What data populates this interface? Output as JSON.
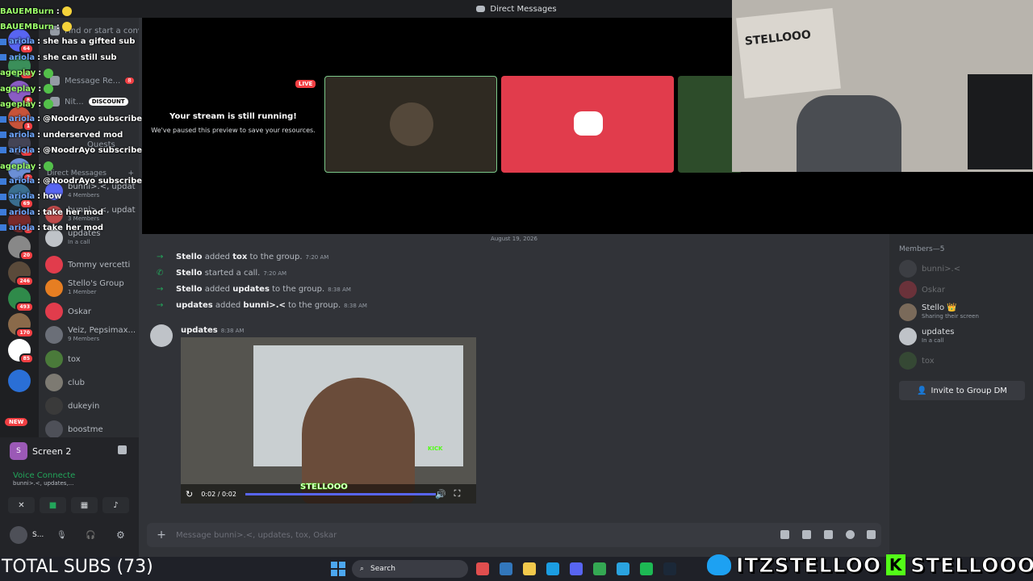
{
  "window": {
    "title": "Direct Messages"
  },
  "dm_sidebar": {
    "nav": [
      {
        "label": "Find or start a convers...",
        "icon": "search-icon"
      },
      {
        "label": "Message Re...",
        "badge": "8",
        "icon": "inbox-icon"
      },
      {
        "label": "Nit...",
        "badge": "DISCOUNT",
        "icon": "nitro-icon"
      },
      {
        "label": "Quests",
        "icon": "quests-icon"
      }
    ],
    "header": "Direct Messages",
    "header_add": "+",
    "dms": [
      {
        "name": "bunni>.<, updat...",
        "sub": "4 Members"
      },
      {
        "name": "bunni>.<, updat...",
        "sub": "3 Members"
      },
      {
        "name": "updates",
        "sub": "In a call"
      },
      {
        "name": "Tommy vercetti",
        "sub": ""
      },
      {
        "name": "Stello's Group",
        "sub": "1 Member"
      },
      {
        "name": "Oskar",
        "sub": ""
      },
      {
        "name": "Veiz, Pepsimax...",
        "sub": "9 Members"
      },
      {
        "name": "tox",
        "sub": ""
      },
      {
        "name": "club",
        "sub": ""
      },
      {
        "name": "dukeyin",
        "sub": ""
      },
      {
        "name": "boostme",
        "sub": ""
      }
    ]
  },
  "server_rail": {
    "badges": [
      "64",
      "95",
      "8",
      "1",
      "17",
      "2",
      "69",
      "5",
      "20",
      "246",
      "493",
      "170",
      "85"
    ],
    "new_label": "NEW"
  },
  "user_panel": {
    "screen_label": "Screen 2",
    "screen_initial": "S",
    "voice_status": "Voice Connecte",
    "voice_channel": "bunni>.<, updates,...",
    "user_short": "S..."
  },
  "stream": {
    "live_badge": "LIVE",
    "running_title": "Your stream is still running!",
    "running_sub": "We've paused this preview to save your resources.",
    "cam_sign": "STELLOOO"
  },
  "chat": {
    "date": "August 19, 2026",
    "events": [
      {
        "actor": "Stello",
        "action": "added",
        "target": "tox",
        "rest": "to the group.",
        "time": "7:20 AM",
        "kind": "join"
      },
      {
        "actor": "Stello",
        "action": "started a call.",
        "target": "",
        "rest": "",
        "time": "7:20 AM",
        "kind": "call"
      },
      {
        "actor": "Stello",
        "action": "added",
        "target": "updates",
        "rest": "to the group.",
        "time": "8:38 AM",
        "kind": "join"
      },
      {
        "actor": "updates",
        "action": "added",
        "target": "bunni>.<",
        "rest": "to the group.",
        "time": "8:38 AM",
        "kind": "join"
      }
    ],
    "message": {
      "author": "updates",
      "time": "8:38 AM"
    },
    "video": {
      "time": "0:02 / 0:02",
      "progress": 1.0,
      "watermark": "STELLOOO",
      "kick_label": "KICK"
    },
    "compose_placeholder": "Message bunni>.<, updates, tox, Oskar"
  },
  "members": {
    "header": "Members—5",
    "list": [
      {
        "name": "bunni>.<",
        "status": "",
        "online": false
      },
      {
        "name": "Oskar",
        "status": "",
        "online": false
      },
      {
        "name": "Stello 👑",
        "status": "Sharing their screen",
        "online": true
      },
      {
        "name": "updates",
        "status": "In a call",
        "online": true
      },
      {
        "name": "tox",
        "status": "",
        "online": false
      }
    ],
    "invite_label": "Invite to Group DM"
  },
  "chat_overlay": [
    {
      "user": "BAUEMBurn",
      "msg": "",
      "emote": true
    },
    {
      "user": "BAUEMBurn",
      "msg": "",
      "emote": true
    },
    {
      "user": "ariola",
      "msg": "she has a gifted sub"
    },
    {
      "user": "ariola",
      "msg": "she can still sub"
    },
    {
      "user": "ageplay",
      "msg": "",
      "emote": true
    },
    {
      "user": "ageplay",
      "msg": "",
      "emote": true
    },
    {
      "user": "ageplay",
      "msg": "",
      "emote": true
    },
    {
      "user": "ariola",
      "msg": "@NoodrAyo subscribe"
    },
    {
      "user": "ariola",
      "msg": "underserved mod"
    },
    {
      "user": "ariola",
      "msg": "@NoodrAyo subscribe"
    },
    {
      "user": "ageplay",
      "msg": "",
      "emote": true
    },
    {
      "user": "ariola",
      "msg": "@NoodrAyo subscribe"
    },
    {
      "user": "ariola",
      "msg": "how"
    },
    {
      "user": "ariola",
      "msg": "take her mod"
    },
    {
      "user": "ariola",
      "msg": "take her mod"
    }
  ],
  "overlay_sep": ":",
  "taskbar": {
    "search_label": "Search",
    "total_subs": "TOTAL SUBS (73)",
    "branding_twitter": "ITZSTELLOO",
    "branding_kick": "STELLOOO",
    "kick_letter": "K",
    "icon_colors": [
      "#e04e4e",
      "#3277bc",
      "#f2c94c",
      "#1b9de2",
      "#5865f2",
      "#34a853",
      "#2aa3e0",
      "#1db954",
      "#1b2838"
    ]
  }
}
